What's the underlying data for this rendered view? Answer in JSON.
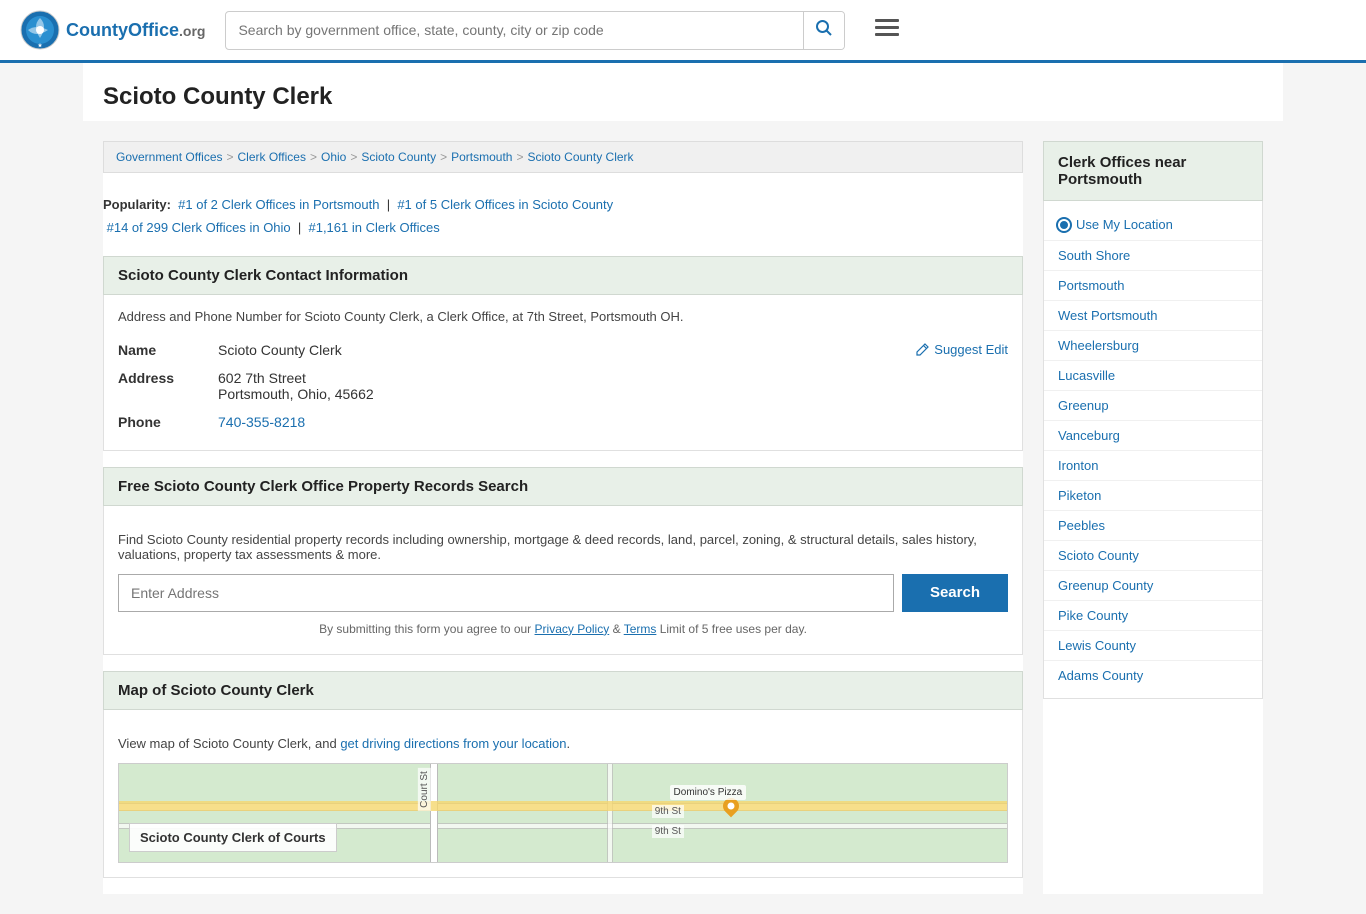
{
  "header": {
    "logo_text": "CountyOffice",
    "logo_org": ".org",
    "search_placeholder": "Search by government office, state, county, city or zip code"
  },
  "page": {
    "title": "Scioto County Clerk",
    "breadcrumb": [
      {
        "label": "Government Offices",
        "href": "#"
      },
      {
        "label": "Clerk Offices",
        "href": "#"
      },
      {
        "label": "Ohio",
        "href": "#"
      },
      {
        "label": "Scioto County",
        "href": "#"
      },
      {
        "label": "Portsmouth",
        "href": "#"
      },
      {
        "label": "Scioto County Clerk",
        "href": "#"
      }
    ]
  },
  "popularity": {
    "label": "Popularity:",
    "rank1_text": "#1 of 2 Clerk Offices in Portsmouth",
    "rank2_text": "#1 of 5 Clerk Offices in Scioto County",
    "rank3_text": "#14 of 299 Clerk Offices in Ohio",
    "rank4_text": "#1,161 in Clerk Offices"
  },
  "contact": {
    "section_title": "Scioto County Clerk Contact Information",
    "description": "Address and Phone Number for Scioto County Clerk, a Clerk Office, at 7th Street, Portsmouth OH.",
    "name_label": "Name",
    "name_value": "Scioto County Clerk",
    "address_label": "Address",
    "address_line1": "602 7th Street",
    "address_line2": "Portsmouth, Ohio, 45662",
    "phone_label": "Phone",
    "phone_value": "740-355-8218",
    "suggest_edit": "Suggest Edit"
  },
  "property_search": {
    "section_title": "Free Scioto County Clerk Office Property Records Search",
    "description": "Find Scioto County residential property records including ownership, mortgage & deed records, land, parcel, zoning, & structural details, sales history, valuations, property tax assessments & more.",
    "input_placeholder": "Enter Address",
    "search_button": "Search",
    "disclaimer": "By submitting this form you agree to our",
    "privacy_policy": "Privacy Policy",
    "and": "&",
    "terms": "Terms",
    "limit_text": "Limit of 5 free uses per day."
  },
  "map_section": {
    "section_title": "Map of Scioto County Clerk",
    "description": "View map of Scioto County Clerk, and",
    "driving_link": "get driving directions from your location",
    "description_end": ".",
    "map_label": "Scioto County Clerk of Courts"
  },
  "sidebar": {
    "title": "Clerk Offices near Portsmouth",
    "use_location": "Use My Location",
    "links": [
      "South Shore",
      "Portsmouth",
      "West Portsmouth",
      "Wheelersburg",
      "Lucasville",
      "Greenup",
      "Vanceburg",
      "Ironton",
      "Piketon",
      "Peebles",
      "Scioto County",
      "Greenup County",
      "Pike County",
      "Lewis County",
      "Adams County"
    ]
  }
}
